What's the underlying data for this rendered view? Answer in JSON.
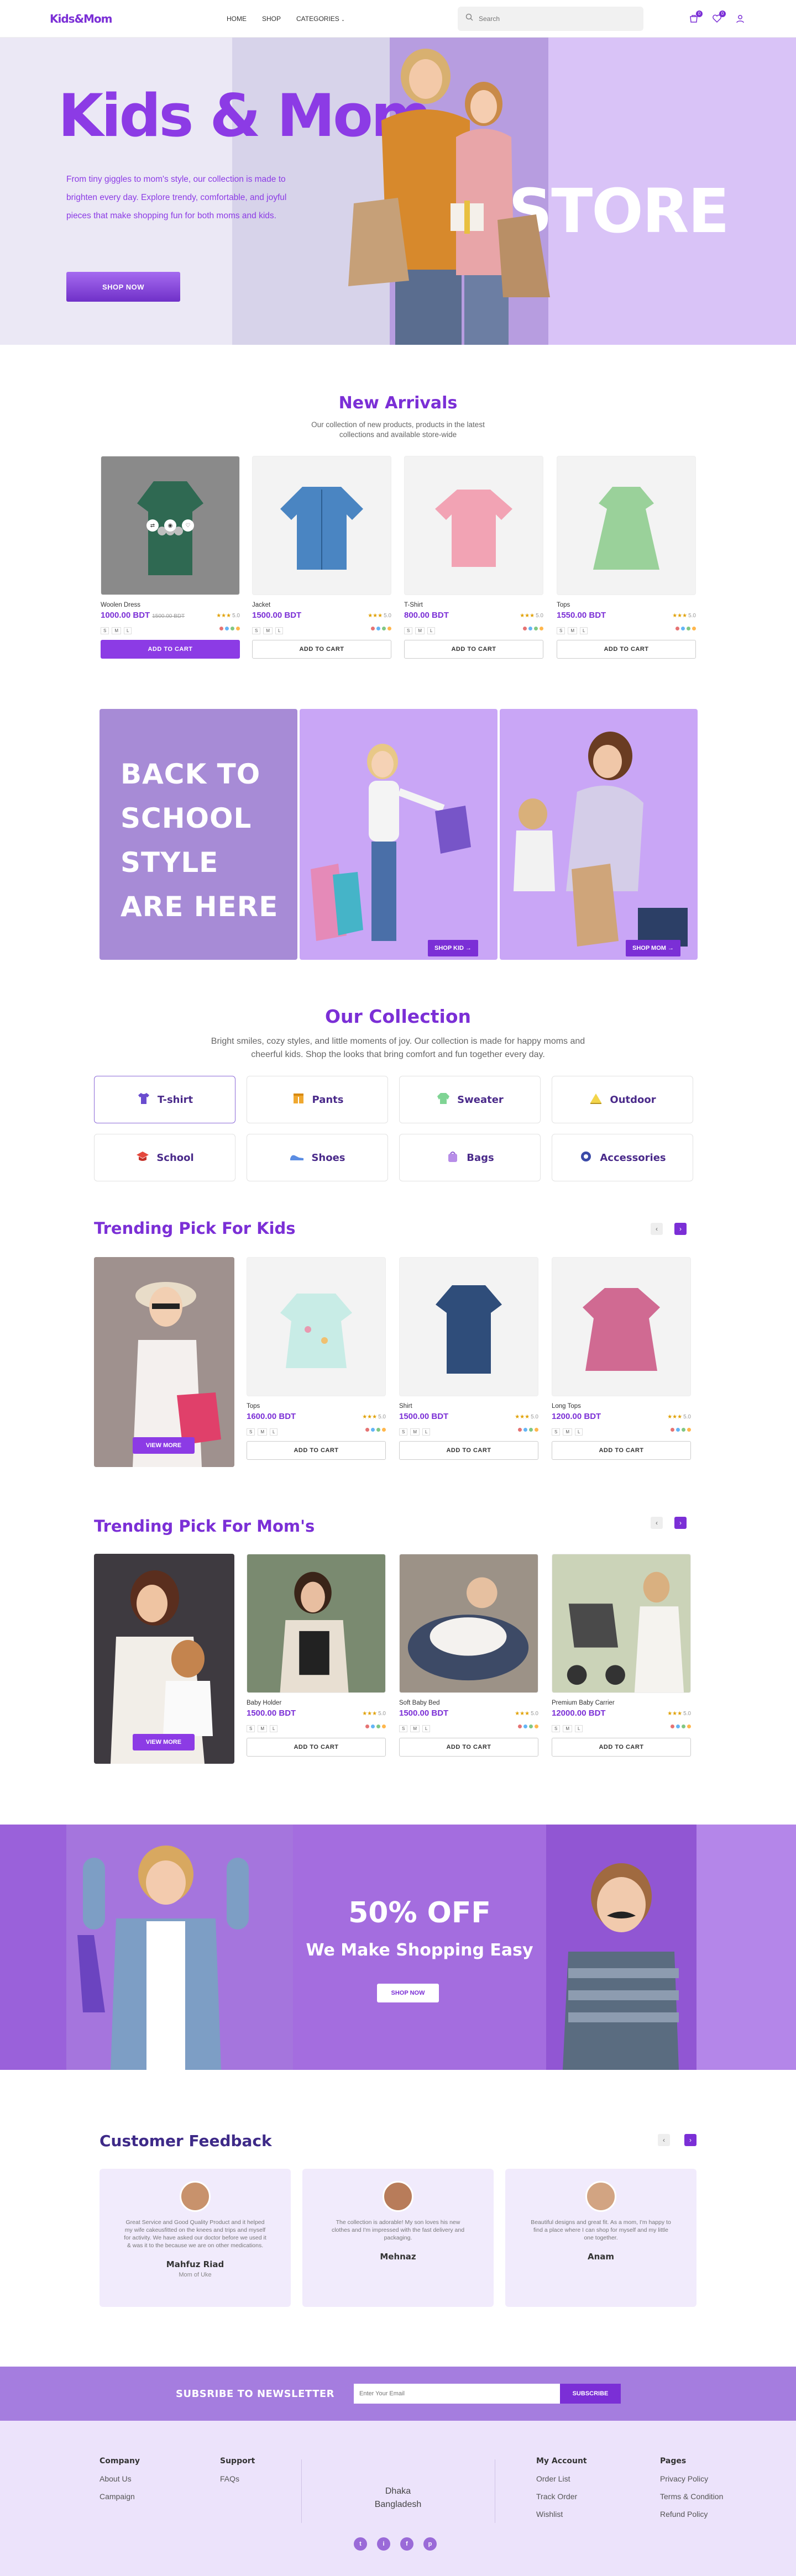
{
  "header": {
    "logo": "Kids&Mom",
    "nav": [
      "HOME",
      "SHOP",
      "CATEGORIES"
    ],
    "search_placeholder": "Search",
    "cart_count": "0",
    "wishlist_count": "0"
  },
  "hero": {
    "title": "Kids & Mom",
    "text": "From tiny giggles to mom's style, our collection is made to brighten every day. Explore trendy, comfortable, and joyful pieces that make shopping fun for both moms and kids.",
    "button": "SHOP NOW",
    "store_word": "STORE"
  },
  "new_arrivals": {
    "title": "New Arrivals",
    "subtitle_1": "Our collection of new products, products in the latest",
    "subtitle_2": "collections and available store-wide",
    "products": [
      {
        "name": "Woolen Dress",
        "price": "1000.00 BDT",
        "old_price": "1500.00 BDT",
        "rating": "5.0",
        "button": "ADD TO CART"
      },
      {
        "name": "Jacket",
        "price": "1500.00 BDT",
        "rating": "5.0",
        "button": "ADD TO CART"
      },
      {
        "name": "T-Shirt",
        "price": "800.00 BDT",
        "rating": "5.0",
        "button": "ADD TO CART"
      },
      {
        "name": "Tops",
        "price": "1550.00 BDT",
        "rating": "5.0",
        "button": "ADD TO CART"
      }
    ],
    "sizes": [
      "S",
      "M",
      "L"
    ]
  },
  "back_to_school": {
    "line1": "BACK TO",
    "line2": "SCHOOL",
    "line3": "STYLE",
    "line4": "ARE HERE",
    "shop_kid": "SHOP KID →",
    "shop_mom": "SHOP MOM →"
  },
  "collection": {
    "title": "Our Collection",
    "subtitle_1": "Bright smiles, cozy styles, and little moments of joy. Our collection is made for happy moms and",
    "subtitle_2": "cheerful kids. Shop the looks that bring comfort and fun together every day.",
    "categories": [
      "T-shirt",
      "Pants",
      "Sweater",
      "Outdoor",
      "School",
      "Shoes",
      "Bags",
      "Accessories"
    ]
  },
  "trending_kids": {
    "title": "Trending Pick For Kids",
    "view_more": "VIEW MORE",
    "products": [
      {
        "name": "Tops",
        "price": "1600.00 BDT",
        "rating": "5.0",
        "button": "ADD TO CART"
      },
      {
        "name": "Shirt",
        "price": "1500.00 BDT",
        "rating": "5.0",
        "button": "ADD TO CART"
      },
      {
        "name": "Long Tops",
        "price": "1200.00 BDT",
        "rating": "5.0",
        "button": "ADD TO CART"
      }
    ]
  },
  "trending_moms": {
    "title": "Trending Pick For Mom's",
    "view_more": "VIEW MORE",
    "products": [
      {
        "name": "Baby Holder",
        "price": "1500.00 BDT",
        "rating": "5.0",
        "button": "ADD TO CART"
      },
      {
        "name": "Soft Baby Bed",
        "price": "1500.00 BDT",
        "rating": "5.0",
        "button": "ADD TO CART"
      },
      {
        "name": "Premium Baby Carrier",
        "price": "12000.00 BDT",
        "rating": "5.0",
        "button": "ADD TO CART"
      }
    ]
  },
  "promo": {
    "big": "50% OFF",
    "sub": "We Make Shopping Easy",
    "button": "SHOP NOW"
  },
  "feedback": {
    "title": "Customer Feedback",
    "items": [
      {
        "text": "Great Service and Good Quality Product and it helped my wife cakeusfitted on the knees and trips and myself for activity. We have asked our doctor before we used it & was it to the because we are on other medications.",
        "name": "Mahfuz Riad",
        "role": "Mom of Uke"
      },
      {
        "text": "The collection is adorable! My son loves his new clothes and I'm impressed with the fast delivery and packaging.",
        "name": "Mehnaz",
        "role": ""
      },
      {
        "text": "Beautiful designs and great fit. As a mom, I'm happy to find a place where I can shop for myself and my little one together.",
        "name": "Anam",
        "role": ""
      }
    ]
  },
  "newsletter": {
    "title": "SUBSRIBE TO NEWSLETTER",
    "placeholder": "Enter Your Email",
    "button": "SUBSCRIBE"
  },
  "footer": {
    "company_title": "Company",
    "company_links": [
      "About Us",
      "Campaign"
    ],
    "support_title": "Support",
    "support_links": [
      "FAQs"
    ],
    "city": "Dhaka",
    "country": "Bangladesh",
    "account_title": "My Account",
    "account_links": [
      "Order List",
      "Track Order",
      "Wishlist"
    ],
    "pages_title": "Pages",
    "pages_links": [
      "Privacy Policy",
      "Terms & Condition",
      "Refund Policy"
    ],
    "social": [
      "t",
      "i",
      "f",
      "p"
    ]
  },
  "colors": {
    "brand": "#7b2fd6",
    "hero_title": "#8c3be5",
    "promo_bg": "#b486e9"
  }
}
